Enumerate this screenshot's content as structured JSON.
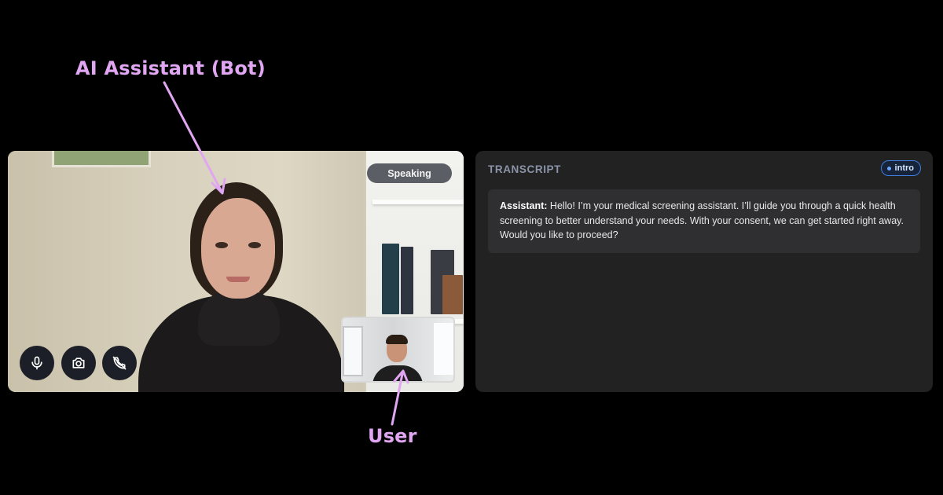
{
  "annotations": {
    "bot_label": "AI Assistant (Bot)",
    "user_label": "User",
    "color": "#e1a6f2"
  },
  "video": {
    "speaking_badge": "Speaking",
    "controls": [
      {
        "name": "microphone",
        "icon": "microphone-icon"
      },
      {
        "name": "camera",
        "icon": "camera-icon"
      },
      {
        "name": "hang-up",
        "icon": "phone-off-icon"
      }
    ]
  },
  "transcript": {
    "title": "TRANSCRIPT",
    "phase": "intro",
    "messages": [
      {
        "speaker": "Assistant:",
        "text": "Hello! I’m your medical screening assistant. I’ll guide you through a quick health screening to better understand your needs. With your consent, we can get started right away. Would you like to proceed?"
      }
    ]
  },
  "colors": {
    "background": "#000000",
    "panel": "#222222",
    "message_bg": "#2f2f31",
    "accent_blue": "#3f7fe0"
  }
}
